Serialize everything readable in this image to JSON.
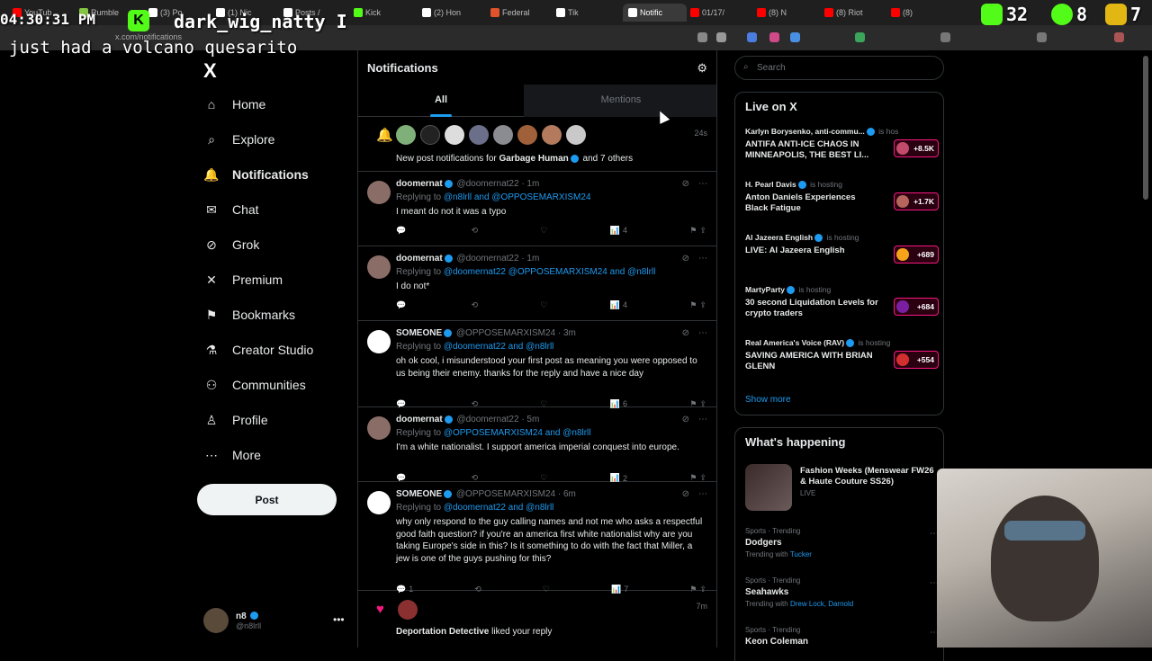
{
  "browser": {
    "tabs": [
      {
        "label": "YouTub",
        "color": "#ff0000"
      },
      {
        "label": "Rumble",
        "color": "#85c742"
      },
      {
        "label": "(3) Po",
        "color": "#ffffff"
      },
      {
        "label": "(1) Nic",
        "color": "#ffffff"
      },
      {
        "label": "Posts /",
        "color": "#ffffff"
      },
      {
        "label": "Kick",
        "color": "#53fc18"
      },
      {
        "label": "(2) Hon",
        "color": "#ffffff"
      },
      {
        "label": "Federal",
        "color": "#e0532b"
      },
      {
        "label": "Tik",
        "color": "#ffffff"
      },
      {
        "label": "Notific",
        "color": "#ffffff"
      },
      {
        "label": "01/17/",
        "color": "#ff0000"
      },
      {
        "label": "(8) N",
        "color": "#ff0000"
      },
      {
        "label": "(8) Riot",
        "color": "#ff0000"
      },
      {
        "label": "(8)",
        "color": "#ff0000"
      }
    ],
    "url": "x.com/notifications"
  },
  "overlay": {
    "time": "04:30:31 PM",
    "kick_letter": "K",
    "username": "dark_wig_natty",
    "cursor_letter": "I",
    "message": "just had a volcano quesarito",
    "stats": [
      {
        "value": "32",
        "color": "#53fc18"
      },
      {
        "value": "8",
        "color": "#53fc18"
      },
      {
        "value": "7",
        "color": "#e2b714"
      }
    ]
  },
  "nav": {
    "logo": "X",
    "items": [
      {
        "label": "Home",
        "icon": "home-icon",
        "glyph": "⌂"
      },
      {
        "label": "Explore",
        "icon": "search-icon",
        "glyph": "⌕"
      },
      {
        "label": "Notifications",
        "icon": "bell-icon",
        "glyph": "🔔"
      },
      {
        "label": "Chat",
        "icon": "mail-icon",
        "glyph": "✉"
      },
      {
        "label": "Grok",
        "icon": "grok-icon",
        "glyph": "⊘"
      },
      {
        "label": "Premium",
        "icon": "x-icon",
        "glyph": "✕"
      },
      {
        "label": "Bookmarks",
        "icon": "bookmark-icon",
        "glyph": "⚑"
      },
      {
        "label": "Creator Studio",
        "icon": "flask-icon",
        "glyph": "⚗"
      },
      {
        "label": "Communities",
        "icon": "people-icon",
        "glyph": "⚇"
      },
      {
        "label": "Profile",
        "icon": "person-icon",
        "glyph": "♙"
      },
      {
        "label": "More",
        "icon": "more-icon",
        "glyph": "⋯"
      }
    ],
    "post_label": "Post",
    "account": {
      "name": "n8",
      "handle": "@n8lrll"
    }
  },
  "main": {
    "title": "Notifications",
    "tabs": {
      "all": "All",
      "mentions": "Mentions"
    },
    "group_notification": {
      "time": "24s",
      "text_prefix": "New post notifications for",
      "name": "Garbage Human",
      "text_suffix": "and 7 others"
    },
    "tweets": [
      {
        "name": "doomernat",
        "handle": "@doomernat22",
        "time": "· 1m",
        "reply_prefix": "Replying to",
        "reply_to": "@n8lrll and @OPPOSEMARXISM24",
        "body": "I meant do not it was a typo",
        "views": "4",
        "replies": "",
        "avatar": "#8a6d66"
      },
      {
        "name": "doomernat",
        "handle": "@doomernat22",
        "time": "· 1m",
        "reply_prefix": "Replying to",
        "reply_to": "@doomernat22 @OPPOSEMARXISM24 and @n8lrll",
        "body": "I do not*",
        "views": "4",
        "replies": "",
        "avatar": "#8a6d66"
      },
      {
        "name": "SOMEONE",
        "handle": "@OPPOSEMARXISM24 · 3m",
        "time": "",
        "reply_prefix": "Replying to",
        "reply_to": "@doomernat22 and @n8lrll",
        "body": "oh ok cool, i misunderstood your first post as meaning you were opposed to us being their enemy. thanks for the reply and have a nice day",
        "views": "6",
        "replies": "",
        "avatar": "#ffffff"
      },
      {
        "name": "doomernat",
        "handle": "@doomernat22",
        "time": "· 5m",
        "reply_prefix": "Replying to",
        "reply_to": "@OPPOSEMARXISM24 and @n8lrll",
        "body": "I'm a white nationalist. I support america imperial conquest into europe.",
        "views": "2",
        "replies": "",
        "avatar": "#8a6d66"
      },
      {
        "name": "SOMEONE",
        "handle": "@OPPOSEMARXISM24 · 6m",
        "time": "",
        "reply_prefix": "Replying to",
        "reply_to": "@doomernat22 and @n8lrll",
        "body": "why only respond to the guy calling names and not me who asks a respectful good faith question? if you're an america first white nationalist why are you taking Europe's side in this? Is it something to do with the fact that Miller, a jew is one of the guys pushing for this?",
        "views": "7",
        "replies": "1",
        "avatar": "#ffffff"
      }
    ],
    "like_notification": {
      "time": "7m",
      "name": "Deportation Detective",
      "text": "liked your reply"
    }
  },
  "right": {
    "search_placeholder": "Search",
    "live_title": "Live on X",
    "live": [
      {
        "host": "Karlyn Borysenko, anti-commu...",
        "status": "is hosting",
        "title": "ANTIFA ANTI-ICE CHAOS IN MINNEAPOLIS, THE BEST LI...",
        "count": "+8.5K",
        "color": "#c24b6b"
      },
      {
        "host": "H. Pearl Davis",
        "status": "is hosting",
        "title": "Anton Daniels Experiences Black Fatigue",
        "count": "+1.7K",
        "color": "#b5655b"
      },
      {
        "host": "Al Jazeera English",
        "status": "is hosting",
        "title": "LIVE: Al Jazeera English",
        "count": "+689",
        "color": "#f7a21b"
      },
      {
        "host": "MartyParty",
        "status": "is hosting",
        "title": "30 second Liquidation Levels for crypto traders",
        "count": "+684",
        "color": "#7b1fa2"
      },
      {
        "host": "Real America's Voice (RAV)",
        "status": "is hosting",
        "title": "SAVING AMERICA WITH BRIAN GLENN",
        "count": "+554",
        "color": "#d32f2f"
      }
    ],
    "show_more": "Show more",
    "happening_title": "What's happening",
    "featured_trend": {
      "title": "Fashion Weeks (Menswear FW26 & Haute Couture SS26)",
      "sub": "LIVE"
    },
    "trends": [
      {
        "category": "Sports · Trending",
        "name": "Dodgers",
        "sub_prefix": "Trending with",
        "sub_links": "Tucker"
      },
      {
        "category": "Sports · Trending",
        "name": "Seahawks",
        "sub_prefix": "Trending with",
        "sub_links": "Drew Lock, Darnold"
      },
      {
        "category": "Sports · Trending",
        "name": "Keon Coleman",
        "sub_prefix": "",
        "sub_links": ""
      }
    ]
  }
}
